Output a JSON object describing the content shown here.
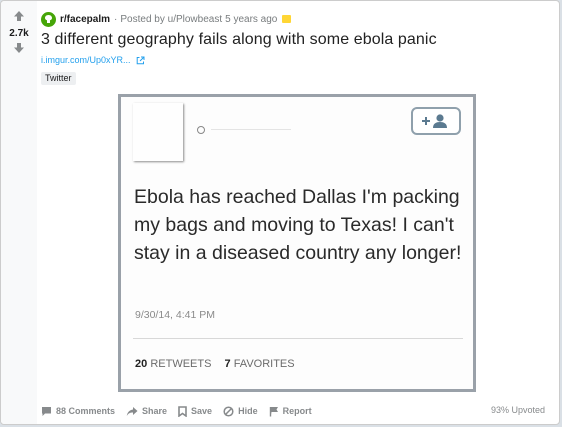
{
  "vote": {
    "score": "2.7k"
  },
  "header": {
    "subreddit": "r/facepalm",
    "separator": "·",
    "posted_by": "Posted by u/Plowbeast",
    "age": "5 years ago"
  },
  "post": {
    "title": "3 different geography fails along with some ebola panic",
    "link_text": "i.imgur.com/Up0xYR...",
    "flair": "Twitter"
  },
  "tweet": {
    "text": "Ebola has reached Dallas I'm packing my bags and moving to Texas! I can't stay in a diseased country any longer!",
    "date": "9/30/14, 4:41 PM",
    "retweets_count": "20",
    "retweets_label": "RETWEETS",
    "favorites_count": "7",
    "favorites_label": "FAVORITES"
  },
  "footer": {
    "comments": "88 Comments",
    "share": "Share",
    "save": "Save",
    "hide": "Hide",
    "report": "Report",
    "upvoted": "93% Upvoted"
  },
  "colors": {
    "subreddit_icon": "#46a508",
    "link": "#24a0ed",
    "award": "#ffd635",
    "muted": "#878a8c"
  },
  "icons": {
    "upvote": "arrow-up-icon",
    "downvote": "arrow-down-icon",
    "subreddit": "subreddit-icon",
    "external_link": "external-link-icon",
    "follow": "add-user-icon",
    "comments": "comment-icon",
    "share": "share-arrow-icon",
    "save": "bookmark-icon",
    "hide": "hide-icon",
    "report": "flag-icon"
  }
}
